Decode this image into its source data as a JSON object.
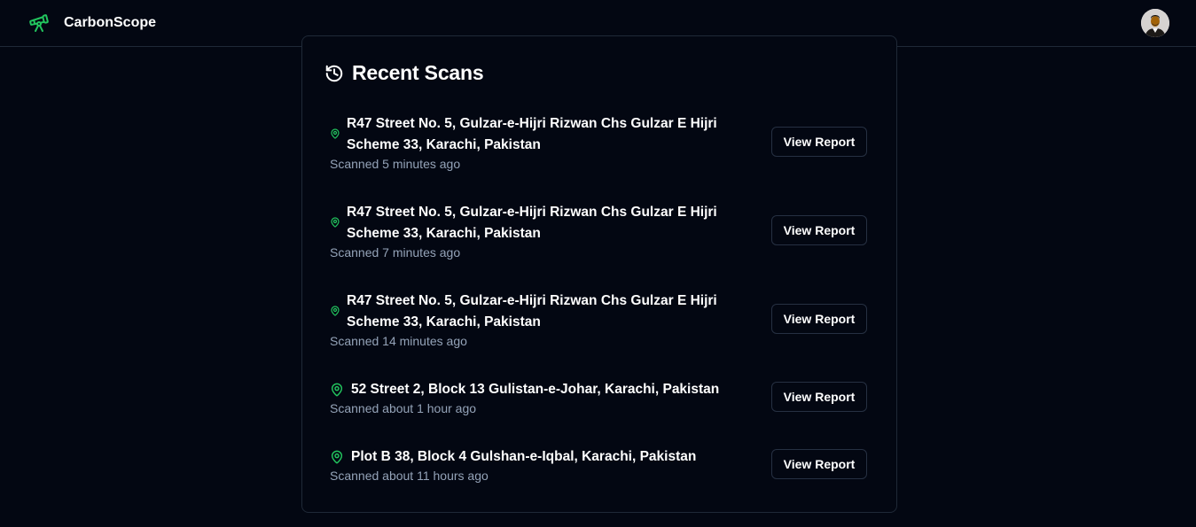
{
  "app": {
    "brand": "CarbonScope",
    "accent_color": "#22c55e",
    "logo_icon": "telescope-icon",
    "avatar_icon": "user-avatar"
  },
  "recent_scans": {
    "title": "Recent Scans",
    "title_icon": "history-icon",
    "items": [
      {
        "address_line1": "R47 Street No. 5, Gulzar-e-Hijri Rizwan Chs Gulzar E Hijri",
        "address_line2": "Scheme 33, Karachi, Pakistan",
        "time": "Scanned 5 minutes ago",
        "button": "View Report"
      },
      {
        "address_line1": "R47 Street No. 5, Gulzar-e-Hijri Rizwan Chs Gulzar E Hijri",
        "address_line2": "Scheme 33, Karachi, Pakistan",
        "time": "Scanned 7 minutes ago",
        "button": "View Report"
      },
      {
        "address_line1": "R47 Street No. 5, Gulzar-e-Hijri Rizwan Chs Gulzar E Hijri",
        "address_line2": "Scheme 33, Karachi, Pakistan",
        "time": "Scanned 14 minutes ago",
        "button": "View Report"
      },
      {
        "address_line1": "52 Street 2, Block 13 Gulistan-e-Johar, Karachi, Pakistan",
        "time": "Scanned about 1 hour ago",
        "button": "View Report"
      },
      {
        "address_line1": "Plot B 38, Block 4 Gulshan-e-Iqbal, Karachi, Pakistan",
        "time": "Scanned about 11 hours ago",
        "button": "View Report"
      }
    ]
  }
}
